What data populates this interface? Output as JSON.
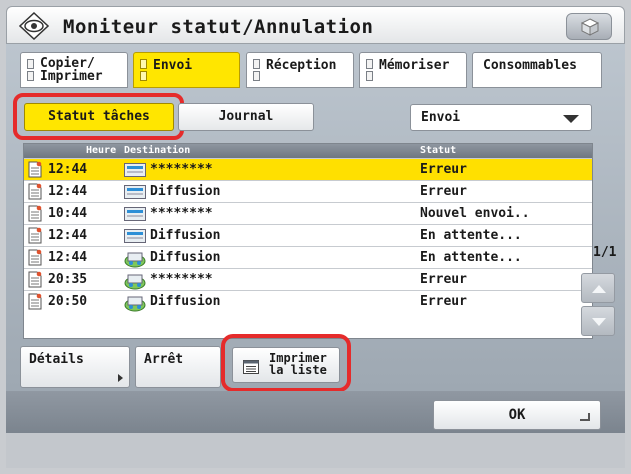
{
  "title": "Moniteur statut/Annulation",
  "tabs": [
    {
      "label": "Copier/\nImprimer",
      "active": false
    },
    {
      "label": "Envoi",
      "active": true
    },
    {
      "label": "Réception",
      "active": false
    },
    {
      "label": "Mémoriser",
      "active": false
    },
    {
      "label": "Consommables",
      "active": false
    }
  ],
  "view_buttons": {
    "status_tasks": "Statut tâches",
    "journal": "Journal"
  },
  "filter_select": {
    "value": "Envoi"
  },
  "table": {
    "headers": {
      "time": "Heure",
      "destination": "Destination",
      "status": "Statut"
    },
    "rows": [
      {
        "time": "12:44",
        "destination": "********",
        "status": "Erreur",
        "selected": true,
        "dest_icon": "fax-icon"
      },
      {
        "time": "12:44",
        "destination": "Diffusion",
        "status": "Erreur",
        "selected": false,
        "dest_icon": "fax-icon"
      },
      {
        "time": "10:44",
        "destination": "********",
        "status": "Nouvel envoi..",
        "selected": false,
        "dest_icon": "fax-icon"
      },
      {
        "time": "12:44",
        "destination": "Diffusion",
        "status": "En attente...",
        "selected": false,
        "dest_icon": "fax-icon"
      },
      {
        "time": "12:44",
        "destination": "Diffusion",
        "status": "En attente...",
        "selected": false,
        "dest_icon": "multi-send-icon"
      },
      {
        "time": "20:35",
        "destination": "********",
        "status": "Erreur",
        "selected": false,
        "dest_icon": "multi-send-icon"
      },
      {
        "time": "20:50",
        "destination": "Diffusion",
        "status": "Erreur",
        "selected": false,
        "dest_icon": "multi-send-icon"
      }
    ]
  },
  "paging": {
    "label": "1/1"
  },
  "actions": {
    "details": "Détails",
    "stop": "Arrêt",
    "print_list": "Imprimer\nla liste"
  },
  "ok_label": "OK",
  "colors": {
    "accent": "#ffe600",
    "highlight": "#e52b2b"
  }
}
